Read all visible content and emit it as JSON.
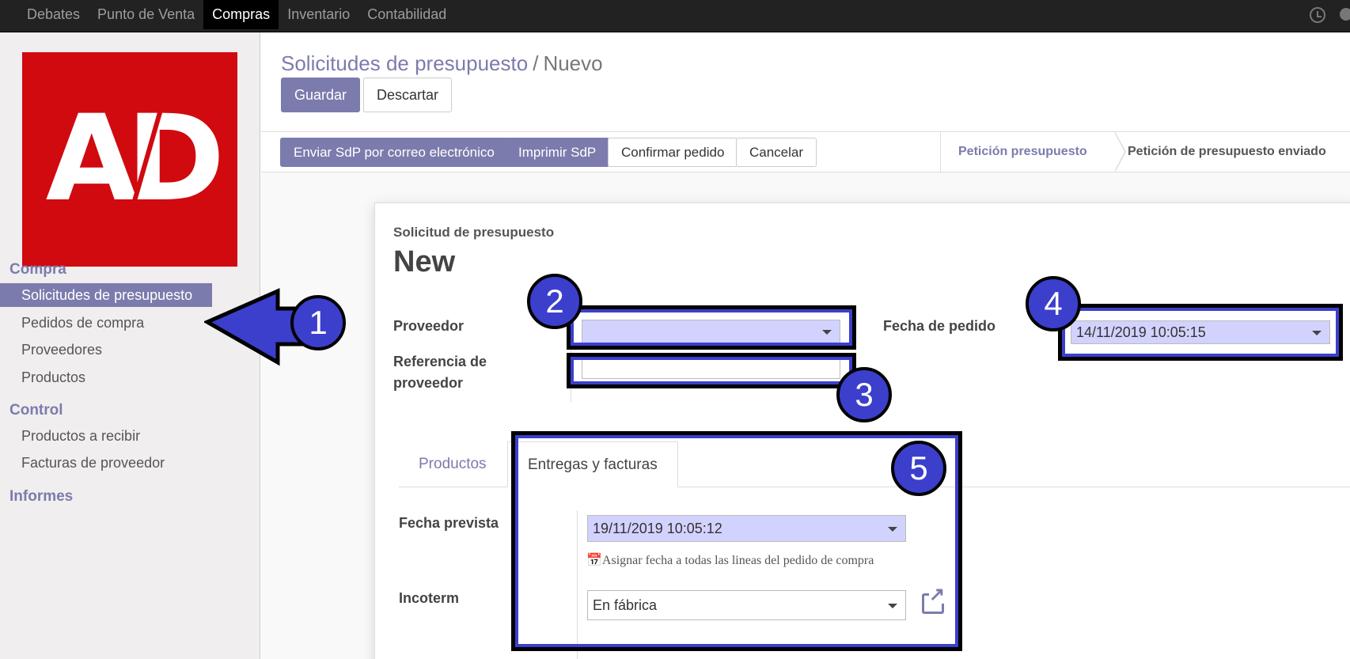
{
  "topbar": {
    "menu": [
      "Debates",
      "Punto de Venta",
      "Compras",
      "Inventario",
      "Contabilidad"
    ],
    "active": "Compras"
  },
  "logo": {
    "text": "AD"
  },
  "sidebar": {
    "sections": [
      {
        "label": "Compra",
        "items": [
          "Solicitudes de presupuesto",
          "Pedidos de compra",
          "Proveedores",
          "Productos"
        ]
      },
      {
        "label": "Control",
        "items": [
          "Productos a recibir",
          "Facturas de proveedor"
        ]
      },
      {
        "label": "Informes",
        "items": []
      }
    ],
    "active_item": "Solicitudes de presupuesto"
  },
  "breadcrumb": {
    "parent": "Solicitudes de presupuesto",
    "separator": "/",
    "current": "Nuevo"
  },
  "actions": {
    "save": "Guardar",
    "discard": "Descartar"
  },
  "statusbar": {
    "buttons": [
      "Enviar SdP por correo electrónico",
      "Imprimir SdP",
      "Confirmar pedido",
      "Cancelar"
    ],
    "stages": [
      "Petición presupuesto",
      "Petición de presupuesto enviado"
    ]
  },
  "form": {
    "subtitle": "Solicitud de presupuesto",
    "title": "New",
    "proveedor_label": "Proveedor",
    "proveedor_value": "",
    "ref_label_line1": "Referencia de",
    "ref_label_line2": "proveedor",
    "ref_value": "",
    "fecha_pedido_label": "Fecha de pedido",
    "fecha_pedido_value": "14/11/2019 10:05:15"
  },
  "tabs": [
    "Productos",
    "Entregas y facturas"
  ],
  "delivery": {
    "fecha_prevista_label": "Fecha prevista",
    "fecha_prevista_value": "19/11/2019 10:05:12",
    "help": "Asignar fecha a todas las lineas del pedido de compra",
    "incoterm_label": "Incoterm",
    "incoterm_value": "En fábrica"
  },
  "annotations": [
    "1",
    "2",
    "3",
    "4",
    "5"
  ],
  "colors": {
    "accent": "#7c7bad",
    "annotation": "#3b3fcc",
    "topbar": "#222222",
    "logo": "#d10a10"
  }
}
